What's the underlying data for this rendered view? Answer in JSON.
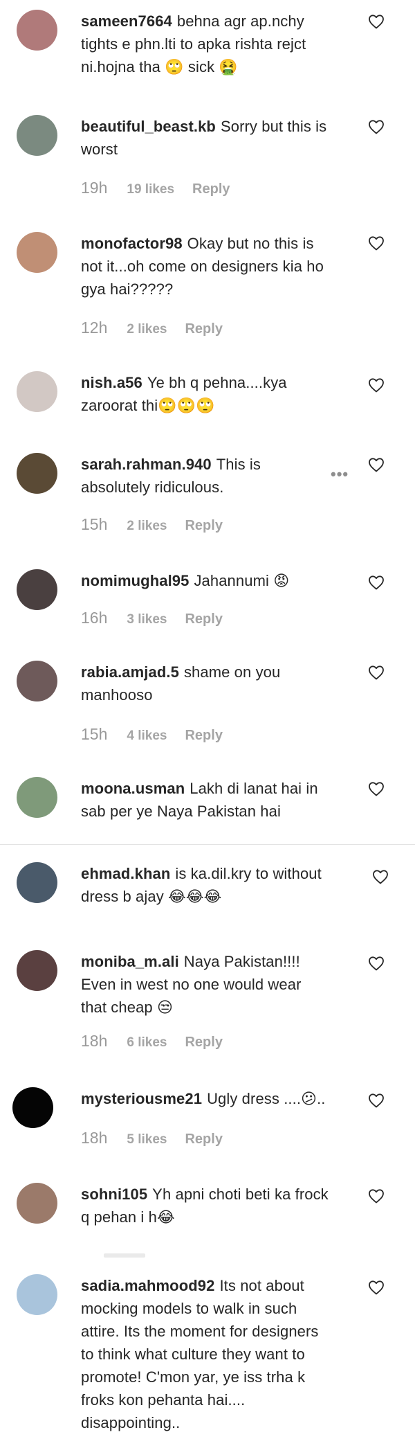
{
  "comments": [
    {
      "username": "sameen7664",
      "text": "behna agr ap.nchy tights e phn.lti to apka rishta rejct ni.hojna tha 🙄 sick 🤮",
      "time": "",
      "likes": "",
      "reply": "",
      "avatar_color": "#b07a7a"
    },
    {
      "username": "beautiful_beast.kb",
      "text": "Sorry but this is worst",
      "time": "19h",
      "likes": "19 likes",
      "reply": "Reply",
      "avatar_color": "#7b8a80"
    },
    {
      "username": "monofactor98",
      "text": "Okay but no this is not it...oh come on designers kia ho gya hai?????",
      "time": "12h",
      "likes": "2 likes",
      "reply": "Reply",
      "avatar_color": "#c08f75"
    },
    {
      "username": "nish.a56",
      "text": "Ye bh q pehna....kya zaroorat thi🙄🙄🙄",
      "time": "",
      "likes": "",
      "reply": "",
      "avatar_color": "#d2c8c4"
    },
    {
      "username": "sarah.rahman.940",
      "text": "This is absolutely ridiculous.",
      "time": "15h",
      "likes": "2 likes",
      "reply": "Reply",
      "avatar_color": "#5a4a35"
    },
    {
      "username": "nomimughal95",
      "text": "Jahannumi 😡",
      "time": "16h",
      "likes": "3 likes",
      "reply": "Reply",
      "avatar_color": "#4a4040"
    },
    {
      "username": "rabia.amjad.5",
      "text": "shame on you manhooso",
      "time": "15h",
      "likes": "4 likes",
      "reply": "Reply",
      "avatar_color": "#6e5a5a"
    },
    {
      "username": "moona.usman",
      "text": "Lakh di lanat hai in sab per ye Naya Pakistan hai",
      "time": "",
      "likes": "",
      "reply": "",
      "avatar_color": "#7f9a7a"
    },
    {
      "username": "ehmad.khan",
      "text": "is ka.dil.kry to without dress b ajay 😂😂😂",
      "time": "",
      "likes": "",
      "reply": "",
      "avatar_color": "#4a5a6a"
    },
    {
      "username": "moniba_m.ali",
      "text": "Naya Pakistan!!!! Even in west no one would wear that cheap 😒",
      "time": "18h",
      "likes": "6 likes",
      "reply": "Reply",
      "avatar_color": "#5a4040"
    },
    {
      "username": "mysteriousme21",
      "text": "Ugly dress ....😕..",
      "time": "18h",
      "likes": "5 likes",
      "reply": "Reply",
      "avatar_color": "#050505"
    },
    {
      "username": "sohni105",
      "text": "Yh apni choti beti ka frock q pehan i h😂",
      "time": "",
      "likes": "",
      "reply": "",
      "avatar_color": "#9b7a6a"
    },
    {
      "username": "sadia.mahmood92",
      "text": "Its not about mocking models to walk in such attire. Its the moment for designers to think what culture they want to promote! C'mon yar, ye iss trha k froks kon pehanta hai.... disappointing..",
      "time": "",
      "likes": "",
      "reply": "",
      "avatar_color": "#a9c4dc"
    }
  ],
  "more_options": "•••"
}
